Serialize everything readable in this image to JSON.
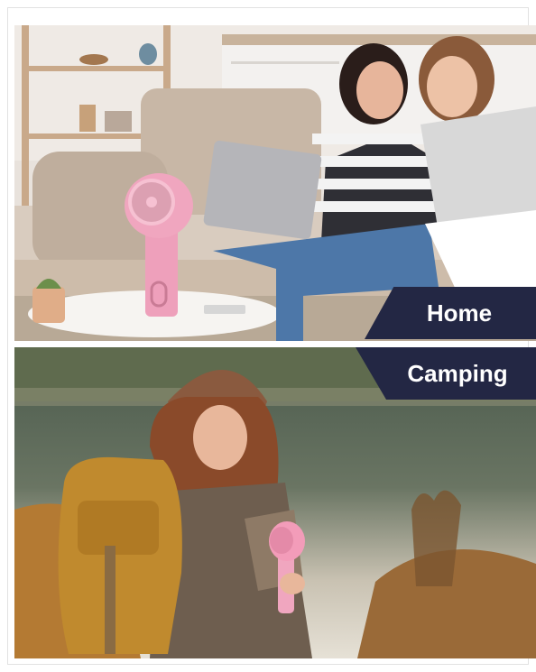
{
  "panels": [
    {
      "label": "Home"
    },
    {
      "label": "Camping"
    }
  ],
  "colors": {
    "label_bg": "#232744",
    "label_text": "#ffffff",
    "fan_pink": "#f0a6bf"
  }
}
